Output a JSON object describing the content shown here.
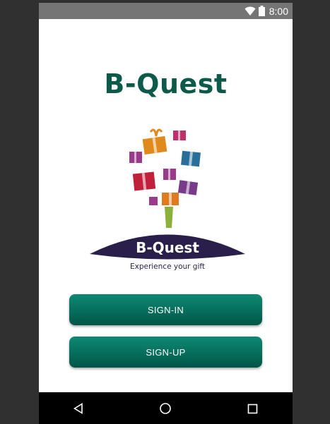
{
  "status_bar": {
    "time": "8:00",
    "icons": [
      "wifi-icon",
      "battery-icon"
    ]
  },
  "app": {
    "title": "B-Quest"
  },
  "logo": {
    "brand": "B-Quest",
    "tagline": "Experience your gift"
  },
  "buttons": {
    "signin_label": "SIGN-IN",
    "signup_label": "SIGN-UP"
  },
  "nav_bar": {
    "icons": [
      "back-icon",
      "home-icon",
      "recents-icon"
    ]
  },
  "colors": {
    "title": "#0d5a4a",
    "button_top": "#0d8a74",
    "button_bottom": "#005548",
    "status_bar": "#757575",
    "nav_bar": "#000000",
    "logo_oval": "#2a1f4a"
  }
}
